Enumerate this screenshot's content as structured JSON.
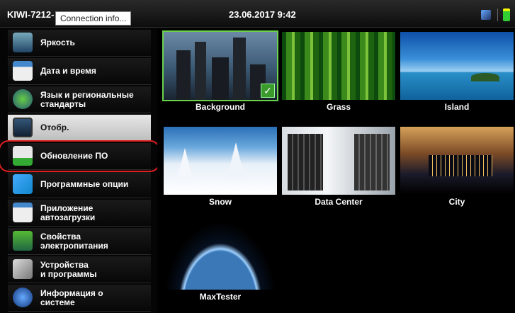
{
  "titlebar": {
    "device_name": "KIWI-7212-",
    "tooltip": "Connection info...",
    "datetime": "23.06.2017 9:42"
  },
  "sidebar": {
    "items": [
      {
        "label": "Яркость",
        "icon": "brightness-icon"
      },
      {
        "label": "Дата и время",
        "icon": "calendar-icon"
      },
      {
        "label": "Язык и региональные\nстандарты",
        "icon": "globe-icon"
      },
      {
        "label": "Отобр.",
        "icon": "display-icon",
        "selected": true
      },
      {
        "label": "Обновление ПО",
        "icon": "update-icon"
      },
      {
        "label": "Программные опции",
        "icon": "puzzle-icon"
      },
      {
        "label": "Приложение\nавтозагрузки",
        "icon": "startup-icon"
      },
      {
        "label": "Свойства\nэлектропитания",
        "icon": "battery-icon"
      },
      {
        "label": "Устройства\nи программы",
        "icon": "tools-icon"
      },
      {
        "label": "Информация о\nсистеме",
        "icon": "info-icon"
      }
    ]
  },
  "wallpapers": [
    {
      "name": "Background",
      "selected": true
    },
    {
      "name": "Grass"
    },
    {
      "name": "Island"
    },
    {
      "name": "Snow"
    },
    {
      "name": "Data Center"
    },
    {
      "name": "City"
    },
    {
      "name": "MaxTester"
    }
  ],
  "colors": {
    "selection_ring": "#e02020",
    "check": "#3b9a2c"
  }
}
